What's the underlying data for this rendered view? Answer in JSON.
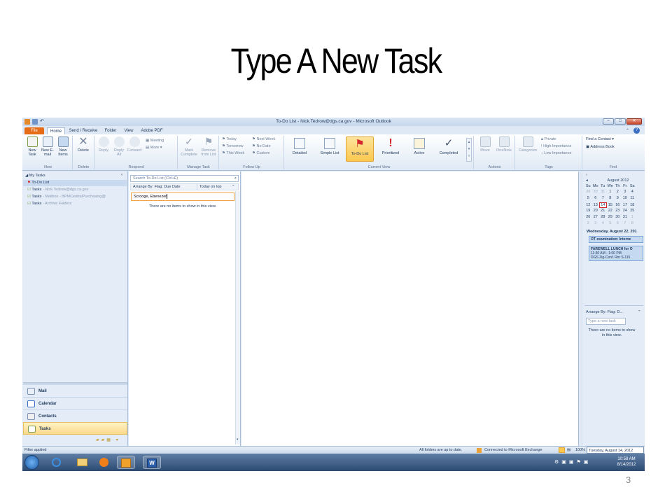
{
  "slide": {
    "title": "Type A New Task",
    "page_number": "3"
  },
  "window": {
    "title": "To-Do List - Nick.Tedrow@dgs.ca.gov - Microsoft Outlook",
    "tabs": [
      "File",
      "Home",
      "Send / Receive",
      "Folder",
      "View",
      "Adobe PDF"
    ]
  },
  "ribbon": {
    "new": {
      "buttons": [
        "New Task",
        "New E-mail",
        "New Items"
      ],
      "label": "New"
    },
    "delete": {
      "buttons": [
        "Delete"
      ],
      "label": "Delete"
    },
    "respond": {
      "buttons": [
        "Reply",
        "Reply All",
        "Forward"
      ],
      "small": [
        "Meeting",
        "More"
      ],
      "label": "Respond"
    },
    "manage": {
      "buttons": [
        "Mark Complete",
        "Remove from List"
      ],
      "label": "Manage Task"
    },
    "follow": {
      "items": [
        "Today",
        "Tomorrow",
        "This Week",
        "Next Week",
        "No Date",
        "Custom"
      ],
      "label": "Follow Up"
    },
    "view": {
      "buttons": [
        "Detailed",
        "Simple List",
        "To-Do List",
        "Prioritized",
        "Active",
        "Completed"
      ],
      "label": "Current View"
    },
    "actions": {
      "buttons": [
        "Move",
        "OneNote"
      ],
      "label": "Actions"
    },
    "tags": {
      "buttons": [
        "Categorize"
      ],
      "items": [
        "Private",
        "High Importance",
        "Low Importance"
      ],
      "label": "Tags"
    },
    "find": {
      "items": [
        "Find a Contact",
        "Address Book"
      ],
      "label": "Find"
    }
  },
  "nav": {
    "header": "My Tasks",
    "items": [
      {
        "label": "To-Do List",
        "extra": ""
      },
      {
        "label": "Tasks",
        "extra": " - Nick.Tedrow@dgs.ca.gov"
      },
      {
        "label": "Tasks",
        "extra": " - Mailbox - BPMCentralPurchasing@"
      },
      {
        "label": "Tasks",
        "extra": " - Archive Folders"
      }
    ],
    "modules": [
      "Mail",
      "Calendar",
      "Contacts",
      "Tasks"
    ]
  },
  "list": {
    "search_placeholder": "Search To-Do List (Ctrl+E)",
    "arrange_by": "Arrange By: Flag: Due Date",
    "sort": "Today on top",
    "new_task_value": "Scrooge, Ebenezer",
    "empty_message": "There are no items to show in this view."
  },
  "todo_bar": {
    "month": "August 2012",
    "weekdays": [
      "Su",
      "Mo",
      "Tu",
      "We",
      "Th",
      "Fr",
      "Sa"
    ],
    "weeks": [
      [
        "29",
        "30",
        "31",
        "1",
        "2",
        "3",
        "4"
      ],
      [
        "5",
        "6",
        "7",
        "8",
        "9",
        "10",
        "11"
      ],
      [
        "12",
        "13",
        "14",
        "15",
        "16",
        "17",
        "18"
      ],
      [
        "19",
        "20",
        "21",
        "22",
        "23",
        "24",
        "25"
      ],
      [
        "26",
        "27",
        "28",
        "29",
        "30",
        "31",
        "1"
      ],
      [
        "2",
        "3",
        "4",
        "5",
        "6",
        "7",
        "8"
      ]
    ],
    "today": "14",
    "date_heading": "Wednesday, August 22, 201",
    "appointments": [
      {
        "lines": [
          "OT examination: Interne"
        ]
      },
      {
        "lines": [
          "FAREWELL LUNCH for O",
          "11:30 AM - 1:00 PM",
          "DGS Zig-Conf. Rm S-115"
        ]
      }
    ],
    "task_arrange": "Arrange By: Flag: D...",
    "task_placeholder": "Type a new task",
    "task_empty": "There are no items to show in this view."
  },
  "status": {
    "left": "Filter applied",
    "sync": "All folders are up to date.",
    "connection": "Connected to Microsoft Exchange",
    "zoom": "100%",
    "date_tooltip": "Tuesday, August 14, 2012"
  },
  "taskbar": {
    "time": "10:58 AM",
    "date": "8/14/2012"
  }
}
